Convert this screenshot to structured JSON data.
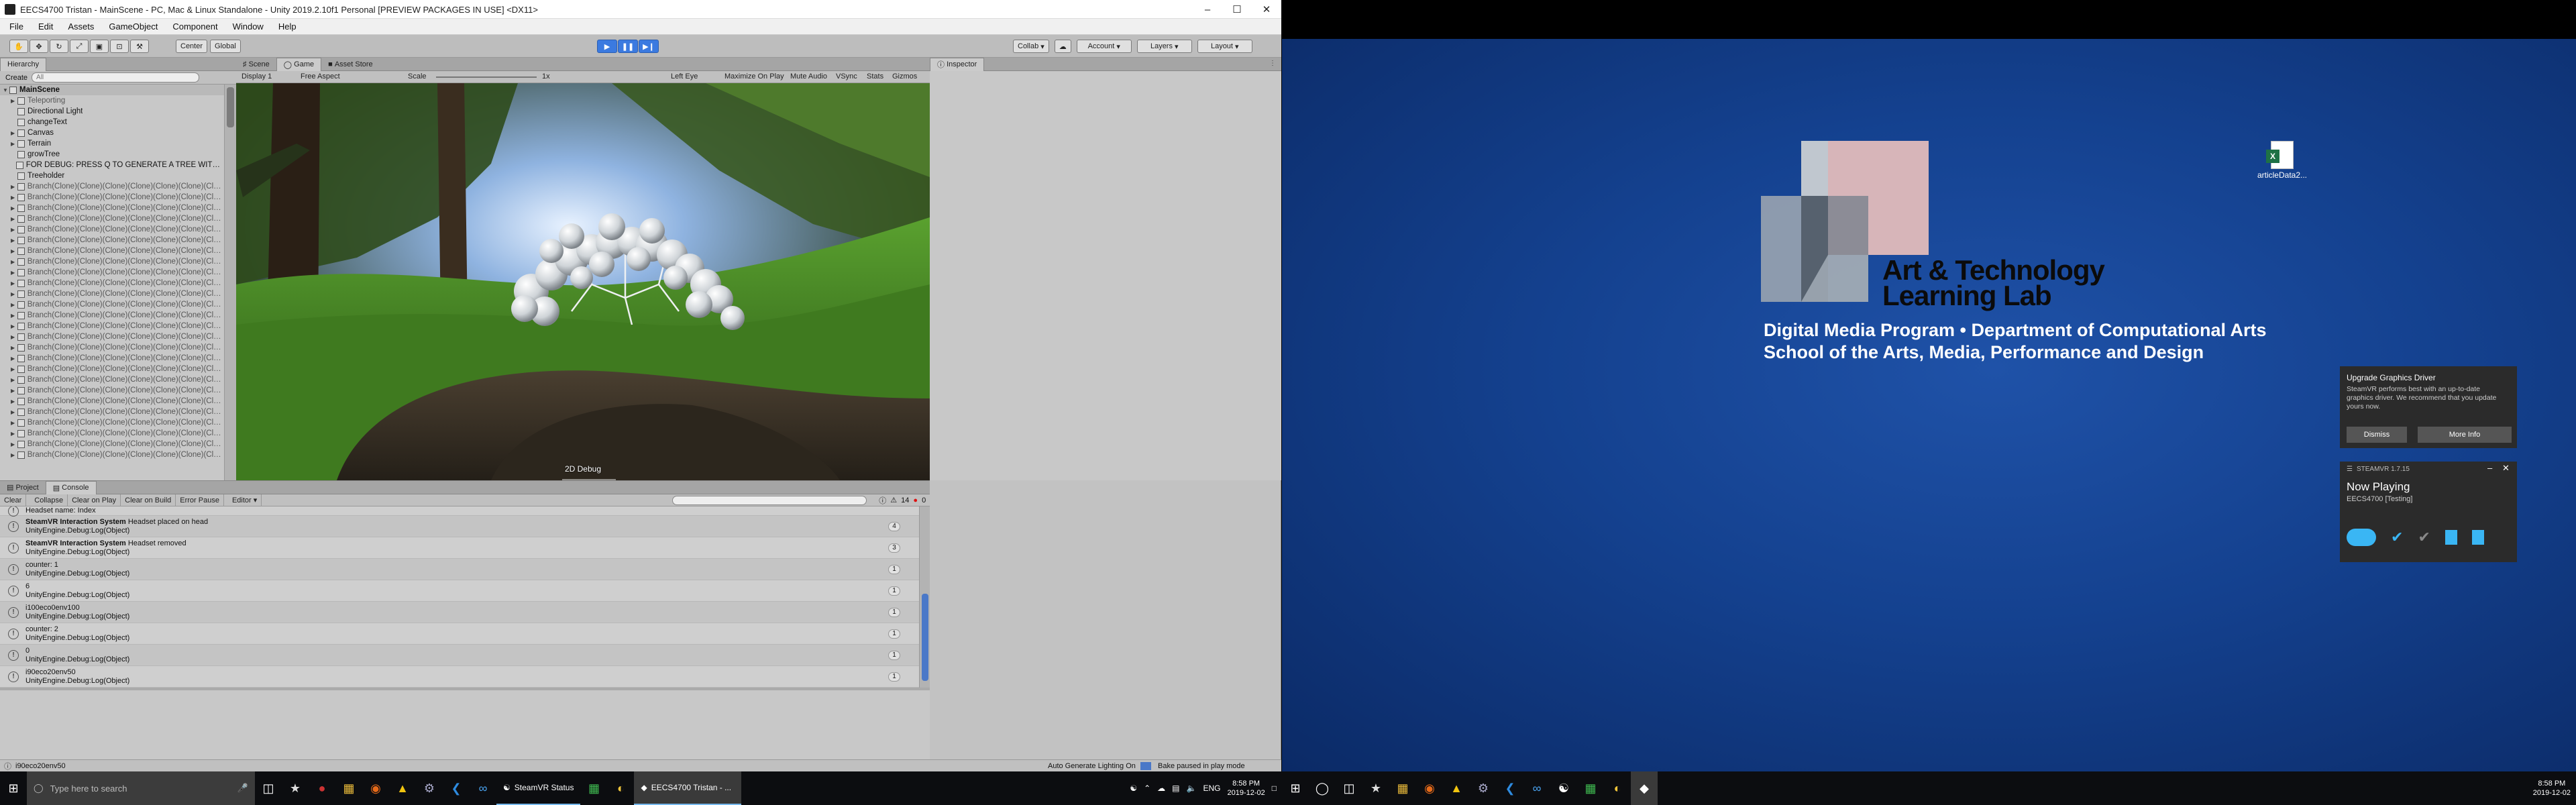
{
  "window": {
    "title": "EECS4700 Tristan - MainScene - PC, Mac & Linux Standalone - Unity 2019.2.10f1 Personal [PREVIEW PACKAGES IN USE] <DX11>"
  },
  "menu": [
    "File",
    "Edit",
    "Assets",
    "GameObject",
    "Component",
    "Window",
    "Help"
  ],
  "toolbar": {
    "center": "Center",
    "global": "Global",
    "collab": "Collab",
    "account": "Account",
    "layers": "Layers",
    "layout": "Layout"
  },
  "hierarchy": {
    "tab": "Hierarchy",
    "create": "Create",
    "search_placeholder": "All",
    "scene": "MainScene",
    "items": [
      {
        "name": "Teleporting",
        "dim": true
      },
      {
        "name": "Directional Light"
      },
      {
        "name": "changeText"
      },
      {
        "name": "Canvas"
      },
      {
        "name": "Terrain"
      },
      {
        "name": "growTree"
      },
      {
        "name": "FOR DEBUG: PRESS Q TO GENERATE A TREE WITH RANDOM ROOTS"
      },
      {
        "name": "Treeholder"
      }
    ],
    "branch": "Branch(Clone)(Clone)(Clone)(Clone)(Clone)(Clone)(Clone)",
    "branch_count": 26
  },
  "tabs": {
    "scene": "Scene",
    "game": "Game",
    "store": "Asset Store",
    "inspector": "Inspector",
    "project": "Project",
    "console": "Console"
  },
  "gamebar": {
    "display": "Display 1",
    "aspect": "Free Aspect",
    "scale_label": "Scale",
    "scale_value": "1x",
    "eye": "Left Eye",
    "maximize": "Maximize On Play",
    "mute": "Mute Audio",
    "vsync": "VSync",
    "stats": "Stats",
    "gizmos": "Gizmos"
  },
  "game_overlay": "2D Debug",
  "consolebar": {
    "clear": "Clear",
    "collapse": "Collapse",
    "clear_on_play": "Clear on Play",
    "clear_on_build": "Clear on Build",
    "error_pause": "Error Pause",
    "editor": "Editor",
    "warn_count": "14",
    "err_count": "0"
  },
  "console": [
    {
      "l1": "UnityEngine.Debug:Log(Object)",
      "l0": "Headset name: Index",
      "cnt": ""
    },
    {
      "bold": "SteamVR Interaction System",
      "l0": " Headset placed on head",
      "l1": "UnityEngine.Debug:Log(Object)",
      "cnt": "4"
    },
    {
      "bold": "SteamVR Interaction System",
      "l0": " Headset removed",
      "l1": "UnityEngine.Debug:Log(Object)",
      "cnt": "3"
    },
    {
      "l0": "counter: 1",
      "l1": "UnityEngine.Debug:Log(Object)",
      "cnt": "1"
    },
    {
      "l0": "6",
      "l1": "UnityEngine.Debug:Log(Object)",
      "cnt": "1"
    },
    {
      "l0": "i100eco0env100",
      "l1": "UnityEngine.Debug:Log(Object)",
      "cnt": "1"
    },
    {
      "l0": "counter: 2",
      "l1": "UnityEngine.Debug:Log(Object)",
      "cnt": "1"
    },
    {
      "l0": "0",
      "l1": "UnityEngine.Debug:Log(Object)",
      "cnt": "1"
    },
    {
      "l0": "i90eco20env50",
      "l1": "UnityEngine.Debug:Log(Object)",
      "cnt": "1"
    }
  ],
  "status": {
    "left": "i90eco20env50",
    "right1": "Auto Generate Lighting On",
    "right2": "Bake paused in play mode"
  },
  "taskbar1": {
    "search": "Type here to search",
    "steamvr": "SteamVR Status",
    "unity": "EECS4700 Tristan - ...",
    "lang": "ENG",
    "time": "8:58 PM",
    "date": "2019-12-02"
  },
  "taskbar2": {
    "time": "8:58 PM",
    "date": "2019-12-02"
  },
  "desktop": {
    "lab1": "Art & Technology",
    "lab2": "Learning Lab",
    "line1": "Digital Media Program • Department of Computational Arts",
    "line2": "School of the Arts, Media, Performance and Design",
    "file": "articleData2...",
    "accent": "#1a4aa0"
  },
  "toast": {
    "title": "Upgrade Graphics Driver",
    "body": "SteamVR performs best with an up-to-date graphics driver. We recommend that you update yours now.",
    "dismiss": "Dismiss",
    "more": "More Info"
  },
  "steamvr": {
    "version": "STEAMVR 1.7.15",
    "playing": "Now Playing",
    "game": "EECS4700 [Testing]"
  }
}
